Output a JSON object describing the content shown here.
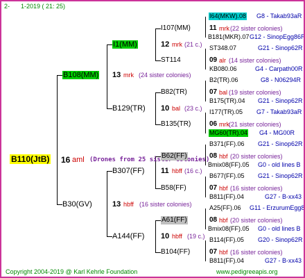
{
  "header": {
    "num": "2-",
    "date_range": "1-2019 ( 21: 25)"
  },
  "footer": {
    "copyright": "Copyright 2004-2019 @ Karl Kehrle Foundation",
    "site": "www.pedigreeapis.org"
  },
  "root": {
    "id": "B110(JtB)",
    "gen": "16",
    "mark": "aml",
    "note": "(Drones from 25 sister colonies)"
  },
  "gen1": {
    "upper": {
      "id": "B108(MM)",
      "gen": "13",
      "mark": "mrk",
      "note": "(24 sister colonies)"
    },
    "lower": {
      "id": "B30(GV)",
      "gen": "13",
      "mark": "hbff",
      "note": "(16 sister colonies)"
    }
  },
  "gen2": {
    "a": {
      "id": "I1(MM)",
      "gen": "12",
      "mark": "mrk",
      "note": "(21 c.)"
    },
    "b": {
      "id": "B129(TR)",
      "gen": "10",
      "mark": "bal",
      "note": "(23 c.)"
    },
    "c": {
      "id": "B307(FF)",
      "gen": "11",
      "mark": "hbff",
      "note": "(16 c.)"
    },
    "d": {
      "id": "A144(FF)",
      "gen": "10",
      "mark": "hbff",
      "note": "(19 c.)"
    }
  },
  "gen3": {
    "a1": {
      "id": "I107(MM)",
      "gen": "11",
      "mark": "mrk",
      "note": "(22 sister colonies)"
    },
    "a2": {
      "id": "ST114",
      "gen": "09",
      "mark": "alr",
      "note": "(14 sister colonies)"
    },
    "b1": {
      "id": "B82(TR)",
      "gen": "07",
      "mark": "bal",
      "note": "(19 sister colonies)"
    },
    "b2": {
      "id": "B135(TR)",
      "gen": "06",
      "mark": "mrk",
      "note": "(21 sister colonies)"
    },
    "c1": {
      "id": "B62(FF)",
      "gen": "08",
      "mark": "hbf",
      "note": "(20 sister colonies)"
    },
    "c2": {
      "id": "B58(FF)",
      "gen": "07",
      "mark": "hbf",
      "note": "(16 sister colonies)"
    },
    "d1": {
      "id": "A61(FF)",
      "gen": "08",
      "mark": "hbf",
      "note": "(20 sister colonies)"
    },
    "d2": {
      "id": "B104(FF)",
      "gen": "07",
      "mark": "hbf",
      "note": "(16 sister colonies)"
    }
  },
  "gen4": [
    {
      "id": "I64(MKW).08",
      "info": "G8 - Takab93aR"
    },
    {
      "id": "B181(MKR).07",
      "info": "G12 - SinopEgg86R"
    },
    {
      "id": "ST348.07",
      "info": "G21 - Sinop62R"
    },
    {
      "id": "KB080.06",
      "info": "G4 - Carpath00R"
    },
    {
      "id": "B2(TR).06",
      "info": "G8 - N06294R"
    },
    {
      "id": "B175(TR).04",
      "info": "G21 - Sinop62R"
    },
    {
      "id": "I177(TR).05",
      "info": "G7 - Takab93aR"
    },
    {
      "id": "MG60(TR).04",
      "info": "G4 - MG00R"
    },
    {
      "id": "B371(FF).06",
      "info": "G21 - Sinop62R"
    },
    {
      "id": "Bmix08(FF).05",
      "info": "G0 - old lines B"
    },
    {
      "id": "B677(FF).05",
      "info": "G21 - Sinop62R"
    },
    {
      "id": "B811(FF).04",
      "info": "G27 - B-xx43"
    },
    {
      "id": "A25(FF).06",
      "info": "G11 - ErzurumEgg8"
    },
    {
      "id": "Bmix08(FF).05",
      "info": "G0 - old lines B"
    },
    {
      "id": "B114(FF).05",
      "info": "G20 - Sinop62R"
    },
    {
      "id": "B811(FF).04",
      "info": "G27 - B-xx43"
    }
  ]
}
